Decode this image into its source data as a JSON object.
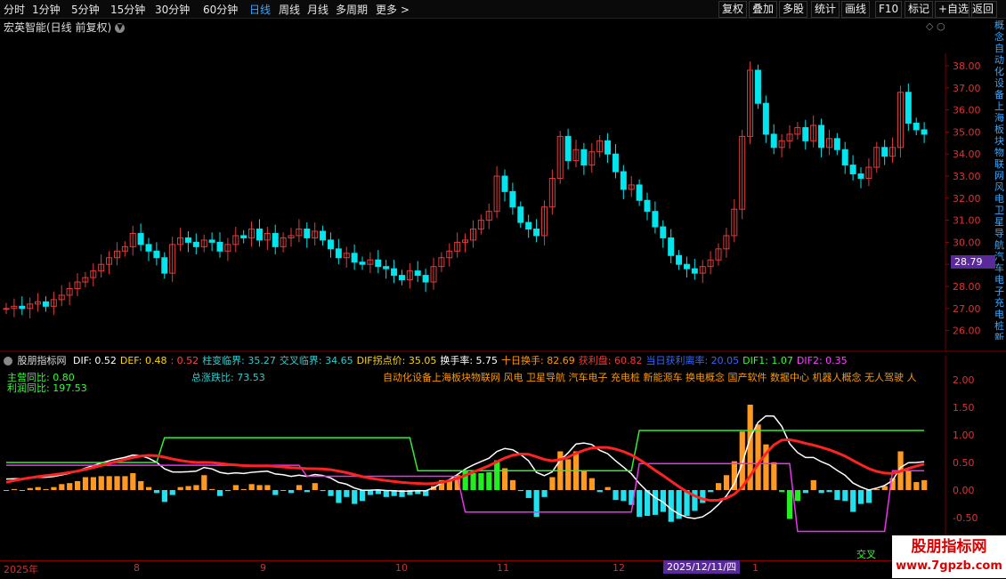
{
  "topbar": {
    "periods": [
      "分时",
      "1分钟",
      "5分钟",
      "15分钟",
      "30分钟",
      "60分钟",
      "日线",
      "周线",
      "月线",
      "多周期",
      "更多 >"
    ],
    "active": "日线",
    "right_buttons": [
      "复权",
      "叠加",
      "多股",
      "统计",
      "画线",
      "F10",
      "标记",
      "+自选",
      "返回"
    ]
  },
  "chart_title": "宏英智能(日线 前复权)",
  "chart_title_icon": "chevron-down-icon",
  "price_axis": [
    "38.00",
    "37.00",
    "36.00",
    "35.00",
    "34.00",
    "33.00",
    "32.00",
    "31.00",
    "30.00",
    "29.00",
    "28.00",
    "27.00",
    "26.00"
  ],
  "current_price_tag": "28.79",
  "side_text": "概念自动化设备上海板块物联网风电卫星导航汽车电子充电桩新能源车换电概念国产软件数据中心机器人",
  "indicator": {
    "name": "股朋指标网",
    "fields": [
      {
        "label": "DIF: 0.52",
        "color": "#ffffff"
      },
      {
        "label": "DEF: 0.48",
        "color": "#ffd700"
      },
      {
        "label": ": 0.52",
        "color": "#ff4444"
      },
      {
        "label": "柱变临界: 35.27",
        "color": "#33cccc"
      },
      {
        "label": "交叉临界: 34.65",
        "color": "#33cccc"
      },
      {
        "label": "DIF拐点价: 35.05",
        "color": "#ffd700"
      },
      {
        "label": "换手率: 5.75",
        "color": "#ffffff"
      },
      {
        "label": "十日换手: 82.69",
        "color": "#ff9900"
      },
      {
        "label": "获利盘: 60.82",
        "color": "#ff3333"
      },
      {
        "label": "当日获利离率: 20.05",
        "color": "#3366ff"
      },
      {
        "label": "DIF1: 1.07",
        "color": "#33ff33"
      },
      {
        "label": "DIF2: 0.35",
        "color": "#ff44ff"
      }
    ],
    "main_yoy": "主营同比: 0.80",
    "profit_yoy": "利润同比: 197.53",
    "total_ratio": "总涨跌比: 73.53",
    "concepts": "自动化设备上海板块物联网 风电 卫星导航 汽车电子 充电桩 新能源车 换电概念 国产软件 数据中心 机器人概念 无人驾驶 人",
    "axis": [
      "2.00",
      "1.50",
      "1.00",
      "0.50",
      "0.00",
      "-0.50"
    ],
    "cross_label": "交叉"
  },
  "dates": {
    "labels": [
      "2025年",
      "8",
      "9",
      "10",
      "11",
      "12",
      "1"
    ],
    "selected": "2025/12/11/四"
  },
  "watermark": {
    "line1": "股朋指标网",
    "line2": "www.7gpzb.com"
  },
  "colors": {
    "up": "#e03c3c",
    "down": "#00e5ee",
    "accent": "#3aa7ff",
    "purple": "#5a2a9a"
  }
}
